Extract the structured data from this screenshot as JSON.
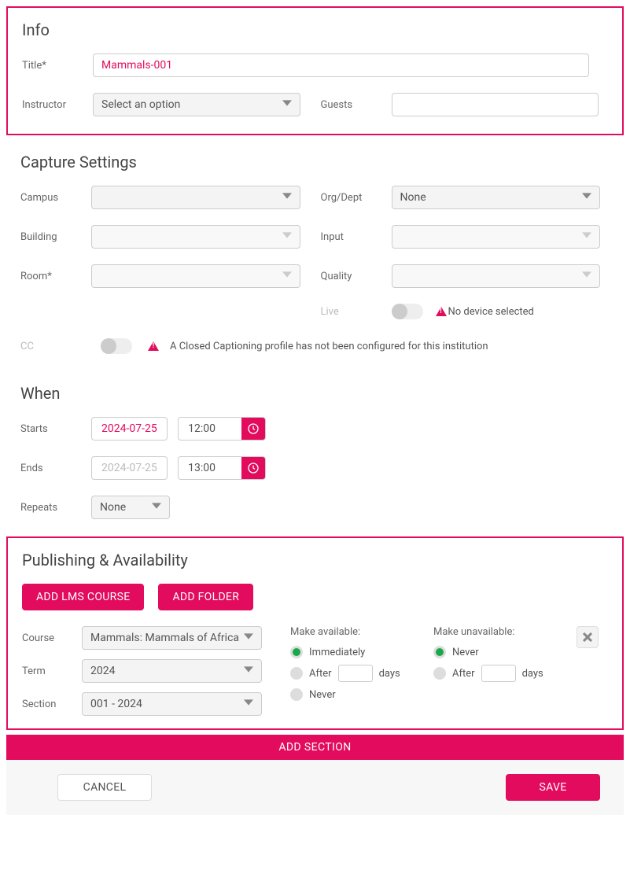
{
  "colors": {
    "accent": "#e30b5d",
    "green": "#1aa84b"
  },
  "info": {
    "heading": "Info",
    "title_label": "Title*",
    "title_value": "Mammals-001",
    "instructor_label": "Instructor",
    "instructor_value": "Select an option",
    "guests_label": "Guests",
    "guests_value": ""
  },
  "capture": {
    "heading": "Capture Settings",
    "campus_label": "Campus",
    "building_label": "Building",
    "room_label": "Room*",
    "orgdept_label": "Org/Dept",
    "orgdept_value": "None",
    "input_label": "Input",
    "quality_label": "Quality",
    "live_label": "Live",
    "live_warning": "No device selected",
    "cc_label": "CC",
    "cc_warning": "A Closed Captioning profile has not been configured for this institution"
  },
  "when": {
    "heading": "When",
    "starts_label": "Starts",
    "starts_date": "2024-07-25",
    "starts_time": "12:00",
    "ends_label": "Ends",
    "ends_date": "2024-07-25",
    "ends_time": "13:00",
    "repeats_label": "Repeats",
    "repeats_value": "None"
  },
  "publishing": {
    "heading": "Publishing & Availability",
    "add_lms_btn": "ADD LMS COURSE",
    "add_folder_btn": "ADD FOLDER",
    "course_label": "Course",
    "course_value": "Mammals: Mammals of Africa",
    "term_label": "Term",
    "term_value": "2024",
    "section_label": "Section",
    "section_value": "001 - 2024",
    "make_available_label": "Make available:",
    "make_unavailable_label": "Make unavailable:",
    "radio_immediately": "Immediately",
    "radio_after": "After",
    "radio_days_suffix": "days",
    "radio_never": "Never"
  },
  "footer": {
    "add_section": "ADD SECTION",
    "cancel": "CANCEL",
    "save": "SAVE"
  }
}
